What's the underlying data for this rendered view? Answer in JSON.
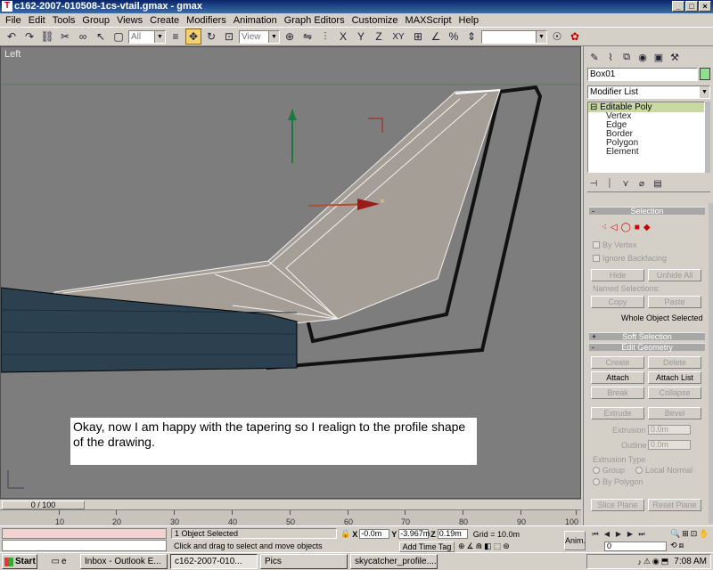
{
  "window": {
    "title": "c162-2007-010508-1cs-vtail.gmax - gmax",
    "min": "_",
    "max": "□",
    "close": "×"
  },
  "menu": [
    "File",
    "Edit",
    "Tools",
    "Group",
    "Views",
    "Create",
    "Modifiers",
    "Animation",
    "Graph Editors",
    "Customize",
    "MAXScript",
    "Help"
  ],
  "toolbar": {
    "filter_value": "All",
    "coord_system": "View",
    "icons": {
      "undo": "↶",
      "redo": "↷",
      "link": "⛓",
      "unlink": "✂",
      "bind": "∞",
      "select": "↖",
      "region": "▢",
      "name": "≡",
      "move": "✥",
      "rotate": "↻",
      "scale": "⊡",
      "center": "⊕",
      "mirror": "⇋",
      "align": "⫶",
      "axis_x": "X",
      "axis_y": "Y",
      "axis_z": "Z",
      "axis_xy": "XY",
      "snap": "⊞",
      "angle": "∠",
      "percent": "%",
      "spinner": "⇕",
      "render": "☉",
      "quick": "✿"
    }
  },
  "viewport": {
    "label": "Left",
    "caption": "Okay, now I am happy with the tapering so I realign to the profile shape of the drawing."
  },
  "command_panel": {
    "object_name": "Box01",
    "object_color": "#8ee08e",
    "modifier_list": "Modifier List",
    "stack_root": "Editable Poly",
    "stack_root_sign": "⊟",
    "stack_items": [
      "Vertex",
      "Edge",
      "Border",
      "Polygon",
      "Element"
    ],
    "selection_rollout": "Selection",
    "by_vertex": "By Vertex",
    "ignore_backfacing": "Ignore Backfacing",
    "hide": "Hide",
    "unhide_all": "Unhide All",
    "named_selections": "Named Selections:",
    "copy": "Copy",
    "paste": "Paste",
    "whole_object": "Whole Object Selected",
    "soft_selection": "Soft Selection",
    "edit_geometry": "Edit Geometry",
    "plus": "+",
    "minus": "-",
    "create": "Create",
    "delete": "Delete",
    "attach": "Attach",
    "attach_list": "Attach List",
    "break": "Break",
    "collapse": "Collapse",
    "extrude": "Extrude",
    "bevel": "Bevel",
    "extrusion_label": "Extrusion",
    "extrusion": "0.0m",
    "outline_label": "Outline",
    "outline": "0.0m",
    "extrusion_type": "Extrusion Type",
    "group": "Group",
    "local_normal": "Local Normal",
    "by_polygon": "By Polygon",
    "slice_plane": "Slice Plane",
    "reset_plane": "Reset Plane"
  },
  "timeline": {
    "slider_label": "0 / 100",
    "ticks": [
      "10",
      "20",
      "30",
      "40",
      "50",
      "60",
      "70",
      "80",
      "90",
      "100"
    ]
  },
  "status": {
    "selection": "1 Object Selected",
    "prompt": "Click and drag to select and move objects",
    "x_label": "X",
    "x": "-0.0m",
    "y_label": "Y",
    "y": "-3.967m",
    "z_label": "Z",
    "z": "0.19m",
    "grid": "Grid = 10.0m",
    "add_time_tag": "Add Time Tag",
    "anim": "Anim.",
    "frame": "0"
  },
  "taskbar": {
    "start": "Start",
    "tasks": [
      "Inbox - Outlook E...",
      "c162-2007-010...",
      "Pics",
      "skycatcher_profile...."
    ],
    "active_index": 1,
    "clock": "7:08 AM"
  }
}
